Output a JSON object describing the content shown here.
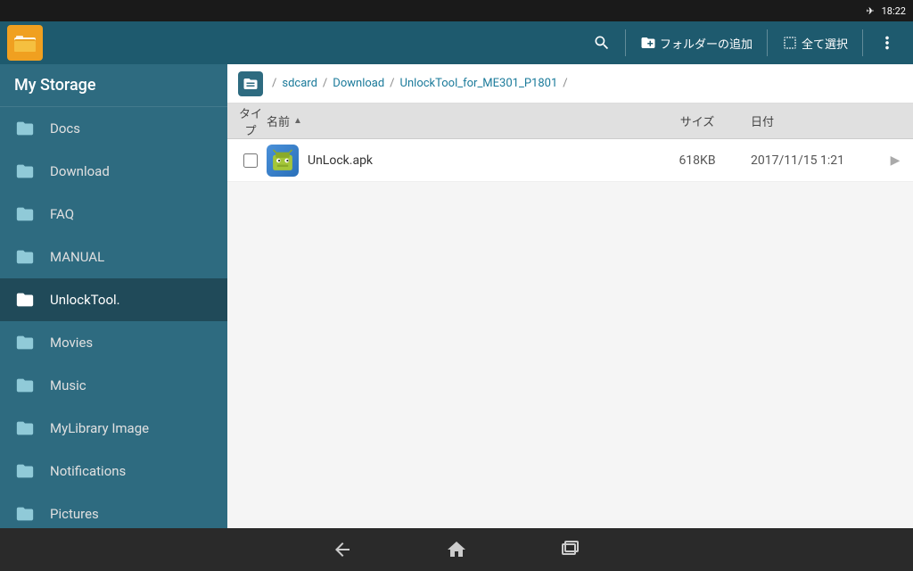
{
  "statusBar": {
    "time": "18:22",
    "airplane": "✈"
  },
  "toolbar": {
    "searchTooltip": "検索",
    "addFolderLabel": "フォルダーの追加",
    "selectAllLabel": "全て選択",
    "menuLabel": "メニュー"
  },
  "sidebar": {
    "title": "My Storage",
    "items": [
      {
        "id": "docs",
        "label": "Docs",
        "active": false
      },
      {
        "id": "download",
        "label": "Download",
        "active": false
      },
      {
        "id": "faq",
        "label": "FAQ",
        "active": false
      },
      {
        "id": "manual",
        "label": "MANUAL",
        "active": false
      },
      {
        "id": "unlocktool",
        "label": "UnlockTool.",
        "active": true
      },
      {
        "id": "movies",
        "label": "Movies",
        "active": false
      },
      {
        "id": "music",
        "label": "Music",
        "active": false
      },
      {
        "id": "mylibrary",
        "label": "MyLibrary Image",
        "active": false
      },
      {
        "id": "notifications",
        "label": "Notifications",
        "active": false
      },
      {
        "id": "pictures",
        "label": "Pictures",
        "active": false
      }
    ]
  },
  "breadcrumb": {
    "icon": "⊟",
    "separator": "/",
    "paths": [
      {
        "label": "sdcard",
        "clickable": true
      },
      {
        "label": "Download",
        "clickable": true
      },
      {
        "label": "UnlockTool_for_ME301_P1801",
        "clickable": true
      }
    ]
  },
  "fileTable": {
    "columns": {
      "type": "タイプ",
      "name": "名前",
      "size": "サイズ",
      "date": "日付"
    },
    "files": [
      {
        "id": "unlock-apk",
        "name": "UnLock.apk",
        "size": "618KB",
        "date": "2017/11/15 1:21",
        "type": "apk"
      }
    ]
  },
  "navBar": {
    "backLabel": "戻る",
    "homeLabel": "ホーム",
    "recentLabel": "最近"
  }
}
